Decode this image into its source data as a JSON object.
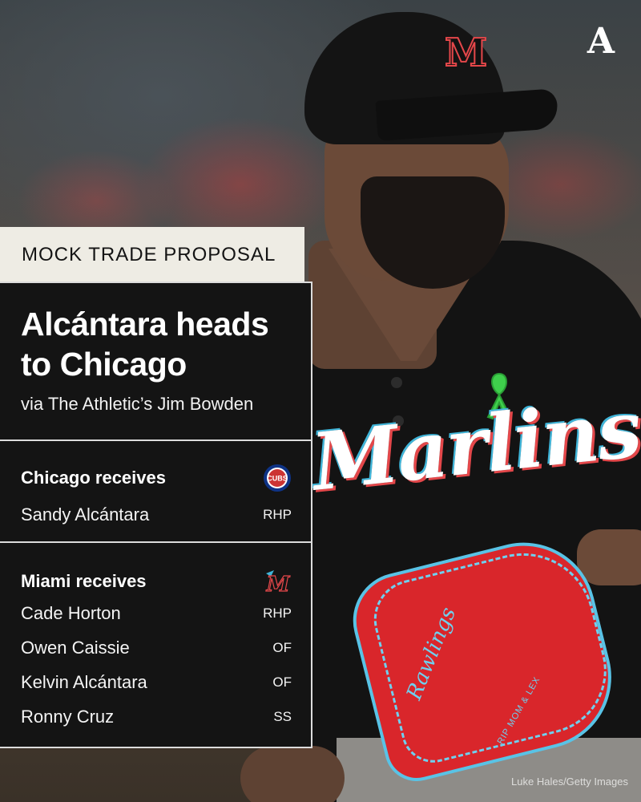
{
  "brand": {
    "logo_letter": "A"
  },
  "header": {
    "label": "MOCK TRADE PROPOSAL"
  },
  "title_panel": {
    "headline_line1": "Alcántara heads",
    "headline_line2": "to Chicago",
    "byline": "via The Athletic’s Jim Bowden"
  },
  "chicago": {
    "heading": "Chicago receives",
    "logo_text": "CUBS",
    "players": [
      {
        "name": "Sandy Alcántara",
        "position": "RHP"
      }
    ]
  },
  "miami": {
    "heading": "Miami receives",
    "logo_text": "M",
    "players": [
      {
        "name": "Cade Horton",
        "position": "RHP"
      },
      {
        "name": "Owen Caissie",
        "position": "OF"
      },
      {
        "name": "Kelvin Alcántara",
        "position": "OF"
      },
      {
        "name": "Ronny Cruz",
        "position": "SS"
      }
    ]
  },
  "photo": {
    "cap_logo": "M",
    "jersey_wordmark": "Marlins",
    "glove_script": "Rawlings",
    "glove_stamp": "RIP MOM & LEX",
    "credit": "Luke Hales/Getty Images"
  },
  "colors": {
    "panel_bg": "#141414",
    "label_bg": "#eeece4",
    "border": "#dcdcdc",
    "cubs_blue": "#0e3386",
    "cubs_red": "#cc3433",
    "marlins_blue": "#3fb5d9",
    "marlins_red": "#e4474a"
  }
}
